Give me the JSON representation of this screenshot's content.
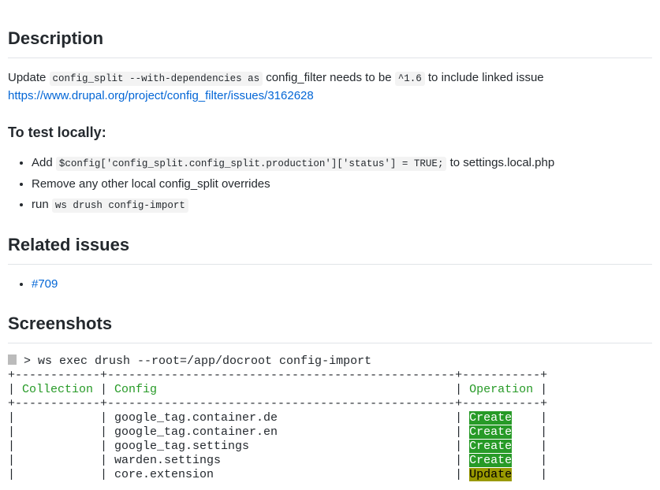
{
  "headings": {
    "description": "Description",
    "testLocally": "To test locally:",
    "relatedIssues": "Related issues",
    "screenshots": "Screenshots"
  },
  "description": {
    "pre": "Update ",
    "code1": "config_split --with-dependencies as",
    "mid": " config_filter needs to be ",
    "code2": "^1.6",
    "post": " to include linked issue ",
    "link": "https://www.drupal.org/project/config_filter/issues/3162628"
  },
  "steps": {
    "step1pre": "Add ",
    "step1code": "$config['config_split.config_split.production']['status'] = TRUE;",
    "step1post": " to settings.local.php",
    "step2": "Remove any other local config_split overrides",
    "step3pre": "run ",
    "step3code": "ws drush config-import"
  },
  "relatedIssue": "#709",
  "terminal": {
    "cmd": " > ws exec drush --root=/app/docroot config-import",
    "border": "+------------+-------------------------------------------------+-----------+",
    "col1": "Collection",
    "col2": "Config",
    "col3": "Operation",
    "rows": [
      {
        "config": "google_tag.container.de",
        "op": "Create",
        "opClass": "tag-create"
      },
      {
        "config": "google_tag.container.en",
        "op": "Create",
        "opClass": "tag-create"
      },
      {
        "config": "google_tag.settings",
        "op": "Create",
        "opClass": "tag-create"
      },
      {
        "config": "warden.settings",
        "op": "Create",
        "opClass": "tag-create"
      },
      {
        "config": "core.extension",
        "op": "Update",
        "opClass": "tag-update"
      }
    ]
  }
}
